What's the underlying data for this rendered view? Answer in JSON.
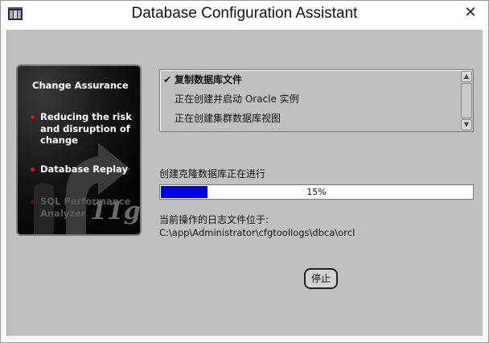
{
  "window": {
    "title": "Database Configuration Assistant",
    "close_glyph": "✕"
  },
  "side_panel": {
    "heading": "Change Assurance",
    "items": [
      {
        "label": "Reducing the risk and disruption of change",
        "state": "highlighted"
      },
      {
        "label": "Database Replay",
        "state": "highlighted"
      },
      {
        "label": "SQL Performance Analyzer",
        "state": "dimmed"
      }
    ],
    "brand": "11g"
  },
  "steps": [
    {
      "label": "复制数据库文件",
      "status": "done",
      "marker": "✔"
    },
    {
      "label": "正在创建并启动 Oracle 实例",
      "status": "pending",
      "marker": ""
    },
    {
      "label": "正在创建集群数据库视图",
      "status": "pending",
      "marker": ""
    }
  ],
  "progress": {
    "label": "创建克隆数据库正在进行",
    "percent": 15,
    "text": "15%",
    "fill_color": "#0000e0"
  },
  "log": {
    "label": "当前操作的日志文件位于:",
    "path": "C:\\app\\Administrator\\cfgtoollogs\\dbca\\orcl"
  },
  "buttons": {
    "stop_label": "停止"
  },
  "icons": {
    "app": "dbca-app-icon",
    "check": "check-icon",
    "scroll_up": "scroll-up-arrow-icon",
    "scroll_down": "scroll-down-arrow-icon"
  }
}
